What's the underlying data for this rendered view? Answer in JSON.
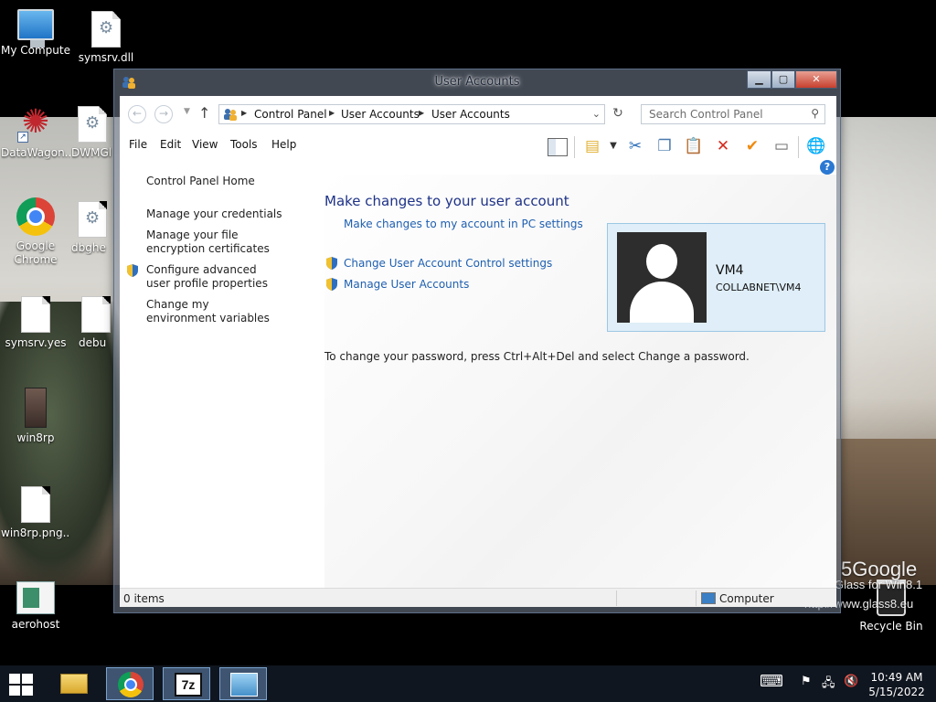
{
  "desktop": {
    "icons": [
      {
        "label": "My Computer"
      },
      {
        "label": "symsrv.dll"
      },
      {
        "label": "DataWagon..."
      },
      {
        "label": "DWMGl"
      },
      {
        "label": "Google Chrome"
      },
      {
        "label": "dbghe"
      },
      {
        "label": "symsrv.yes"
      },
      {
        "label": "debu"
      },
      {
        "label": "win8rp"
      },
      {
        "label": "win8rp.png...."
      },
      {
        "label": "aerohost"
      },
      {
        "label": "Recycle Bin"
      }
    ],
    "watermark": {
      "line1": "5Google",
      "line2": "Glass for Win8.1",
      "line3": "http://www.glass8.eu"
    }
  },
  "window": {
    "title": "User Accounts",
    "address": {
      "crumbs": [
        "Control Panel",
        "User Accounts",
        "User Accounts"
      ]
    },
    "search_placeholder": "Search Control Panel",
    "menu": [
      "File",
      "Edit",
      "View",
      "Tools",
      "Help"
    ],
    "left_pane": {
      "home": "Control Panel Home",
      "links": [
        "Manage your credentials",
        "Manage your file encryption certificates",
        "Configure advanced user profile properties",
        "Change my environment variables"
      ]
    },
    "main": {
      "heading": "Make changes to your user account",
      "pc_settings_link": "Make changes to my account in PC settings",
      "uac_link": "Change User Account Control settings",
      "manage_link": "Manage User Accounts",
      "password_note": "To change your password, press Ctrl+Alt+Del and select Change a password."
    },
    "user": {
      "name": "VM4",
      "domain": "COLLABNET\\VM4"
    },
    "status": {
      "items": "0 items",
      "location": "Computer"
    }
  },
  "taskbar": {
    "time": "10:49 AM",
    "date": "5/15/2022",
    "zip_label": "7z"
  }
}
